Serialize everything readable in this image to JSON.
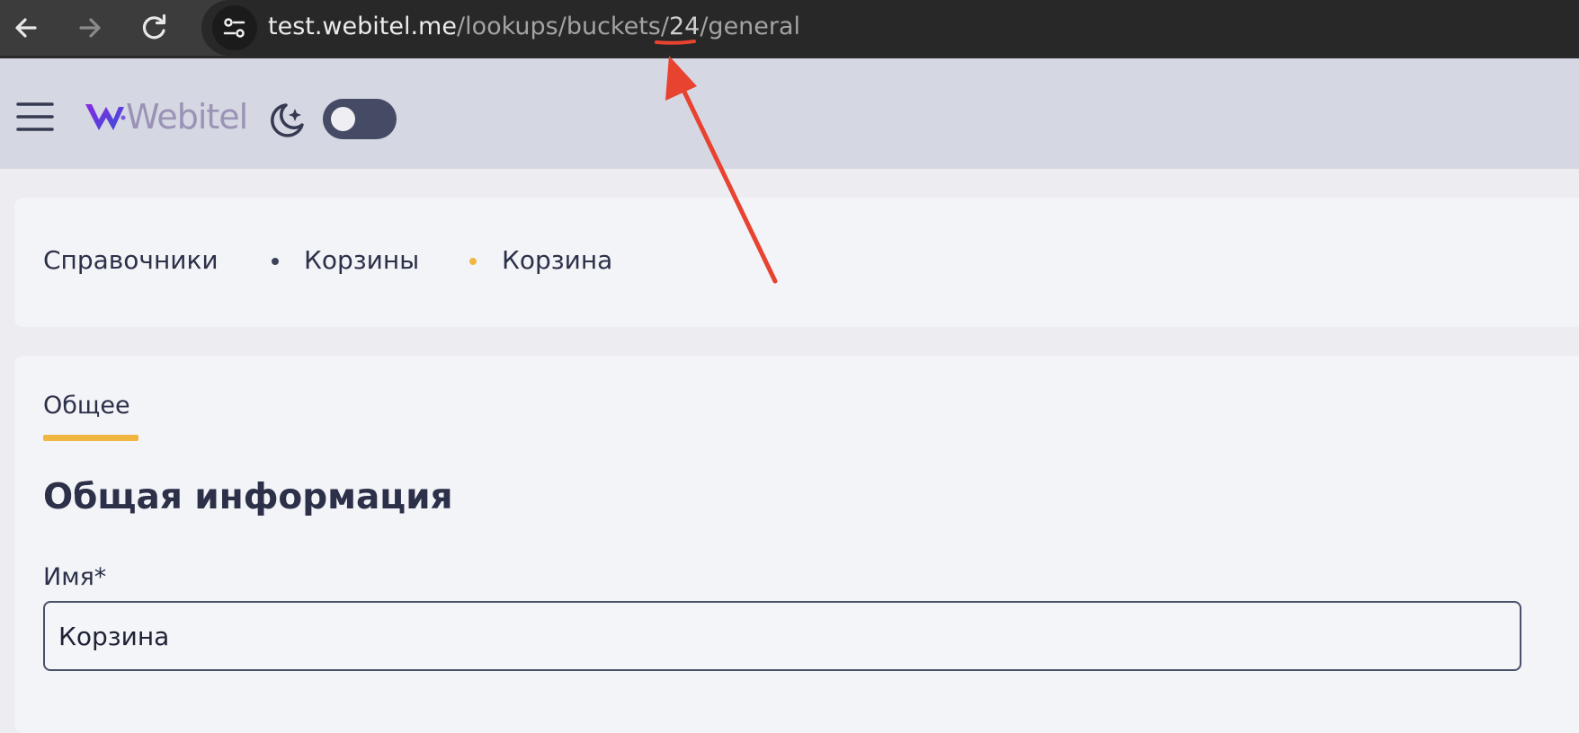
{
  "browser": {
    "url_host": "test.webitel.me",
    "url_path_before": "/lookups/buckets/",
    "url_id": "24",
    "url_path_after": "/general"
  },
  "app": {
    "logo_text": "Webitel",
    "icons": {
      "menu": "hamburger-menu-icon",
      "theme": "moon-icon",
      "logo": "webitel-logo-icon"
    },
    "theme_toggle_on": false
  },
  "breadcrumb": [
    "Справочники",
    "Корзины",
    "Корзина"
  ],
  "tabs": [
    {
      "label": "Общее",
      "active": true
    }
  ],
  "section_title": "Общая информация",
  "form": {
    "name_label": "Имя*",
    "name_value": "Корзина"
  },
  "colors": {
    "accent": "#f0b63f",
    "annotation": "#e84230",
    "header_bg": "#d5d7e2",
    "text": "#2c3048"
  }
}
